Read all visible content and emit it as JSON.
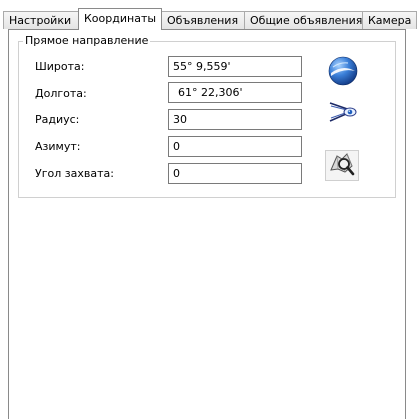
{
  "tabs": [
    {
      "label": "Настройки",
      "active": false
    },
    {
      "label": "Координаты",
      "active": true
    },
    {
      "label": "Объявления",
      "active": false
    },
    {
      "label": "Общие объявления",
      "active": false
    },
    {
      "label": "Камера",
      "active": false
    }
  ],
  "group": {
    "title": "Прямое направление"
  },
  "fields": {
    "latitude": {
      "label": "Широта:",
      "value": "55° 9,559'"
    },
    "longitude": {
      "label": "Долгота:",
      "value": "61° 22,306'"
    },
    "radius": {
      "label": "Радиус:",
      "value": "30"
    },
    "azimuth": {
      "label": "Азимут:",
      "value": "0"
    },
    "capture_angle": {
      "label": "Угол захвата:",
      "value": "0"
    }
  },
  "icons": {
    "globe": "globe-icon",
    "view_cone": "view-cone-icon",
    "search_map": "map-search-icon"
  },
  "colors": {
    "border": "#8a8a8a",
    "globe_blue": "#1f5fbf"
  }
}
